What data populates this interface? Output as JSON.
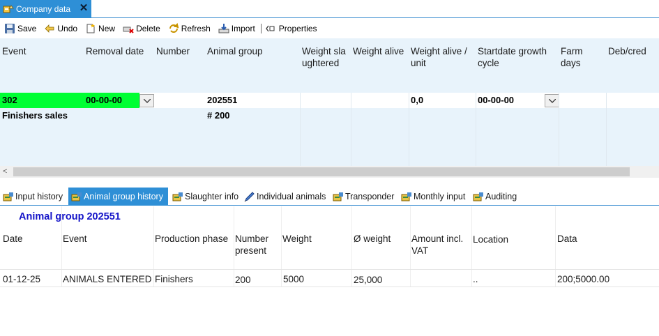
{
  "window": {
    "tab_title": "Company data",
    "close_glyph": "✕",
    "tab_icon": "company-data-icon"
  },
  "toolbar": {
    "save": "Save",
    "undo": "Undo",
    "new": "New",
    "delete": "Delete",
    "refresh": "Refresh",
    "import": "Import",
    "properties": "Properties"
  },
  "grid": {
    "columns": [
      "Event",
      "Removal date",
      "Number",
      "Animal group",
      "Weight slaughtered",
      "Weight alive",
      "Weight alive / unit",
      "Startdate growth cycle",
      "Farm days",
      "Deb/cred"
    ],
    "row": {
      "event": "302",
      "removal_date": "00-00-00",
      "number": "",
      "animal_group": "202551",
      "weight_slaughtered": "",
      "weight_alive": "",
      "weight_alive_unit": "0,0",
      "startdate": "00-00-00",
      "farm_days": "",
      "debcred": ""
    },
    "summary": {
      "label": "Finishers sales",
      "group_total": "# 200"
    },
    "highlight_color": "#00ff33"
  },
  "scroll": {
    "left_arrow": "<"
  },
  "bottom_tabs": [
    "Input history",
    "Animal group history",
    "Slaughter info",
    "Individual animals",
    "Transponder",
    "Monthly input",
    "Auditing"
  ],
  "active_bottom_tab": "Animal group history",
  "history": {
    "title": "Animal group  202551",
    "columns": [
      "Date",
      "Event",
      "Production phase",
      "Number present",
      "Weight",
      "Ø weight",
      "Amount incl. VAT",
      "Location",
      "Data"
    ],
    "rows": [
      {
        "date": "01-12-25",
        "event": "ANIMALS ENTERED",
        "phase": "Finishers",
        "number": "200",
        "weight": "5000",
        "avg_weight": "25,000",
        "amount": "",
        "location": "..",
        "data": "200;5000.00"
      }
    ]
  }
}
